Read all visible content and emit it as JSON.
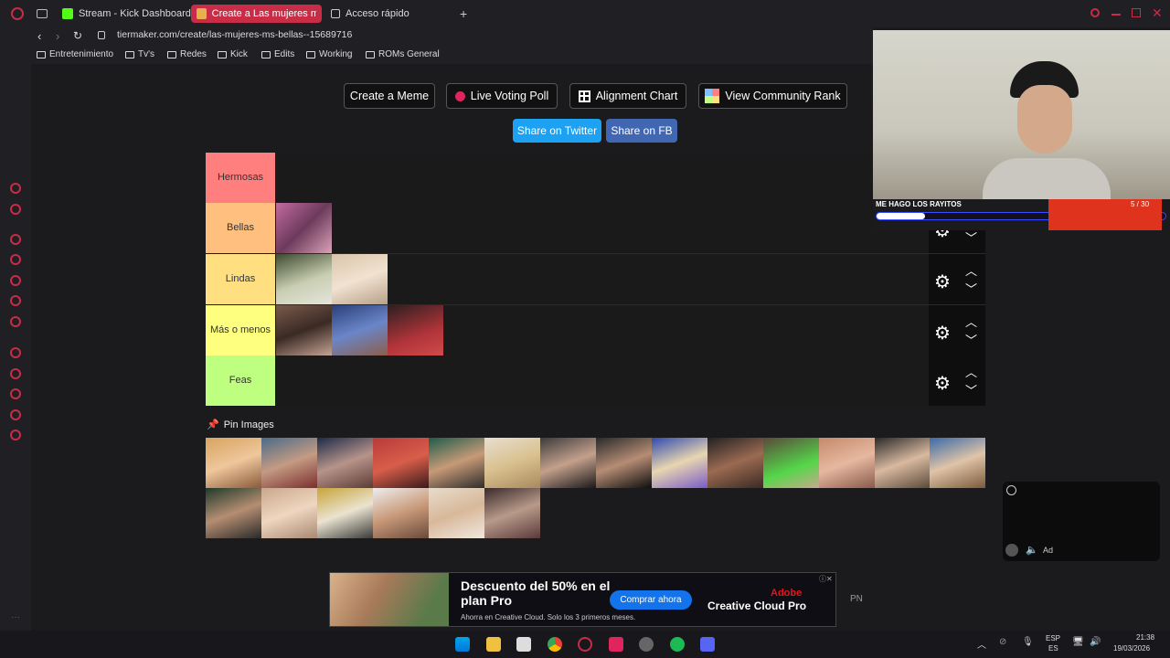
{
  "browser": {
    "tabs": [
      {
        "label": "Stream - Kick Dashboard"
      },
      {
        "label": "Create a Las mujeres más"
      },
      {
        "label": "Acceso rápido"
      }
    ],
    "url": "tiermaker.com/create/las-mujeres-ms-bellas--15689716",
    "bookmarks": [
      "Entretenimiento",
      "Tv's",
      "Redes",
      "Kick",
      "Edits",
      "Working",
      "ROMs General"
    ]
  },
  "toolbar": {
    "create_meme": "Create a Meme",
    "live_poll": "Live Voting Poll",
    "alignment_chart": "Alignment Chart",
    "community_rank": "View Community Rank",
    "share_twitter": "Share on Twitter",
    "share_fb": "Share on FB"
  },
  "tiers": [
    {
      "label": "Hermosas",
      "color": "#ff7f7f"
    },
    {
      "label": "Bellas",
      "color": "#ffbf7f"
    },
    {
      "label": "Lindas",
      "color": "#ffdf7f"
    },
    {
      "label": "Más o menos",
      "color": "#ffff7f"
    },
    {
      "label": "Feas",
      "color": "#bfff7f"
    }
  ],
  "pin_images_label": "Pin Images",
  "overlay": {
    "title": "ME HAGO LOS RAYITOS",
    "counter": "5 / 30"
  },
  "ad": {
    "headline": "Descuento del 50% en el plan Pro",
    "subtext": "Ahorra en Creative Cloud. Solo los 3 primeros meses.",
    "cta": "Comprar ahora",
    "brand": "Adobe",
    "product": "Creative Cloud Pro",
    "side": "PN"
  },
  "widget": {
    "ad_label": "Ad"
  },
  "taskbar": {
    "lang": "ESP",
    "lang2": "ES",
    "time": "21:38",
    "date": "19/03/2026"
  }
}
